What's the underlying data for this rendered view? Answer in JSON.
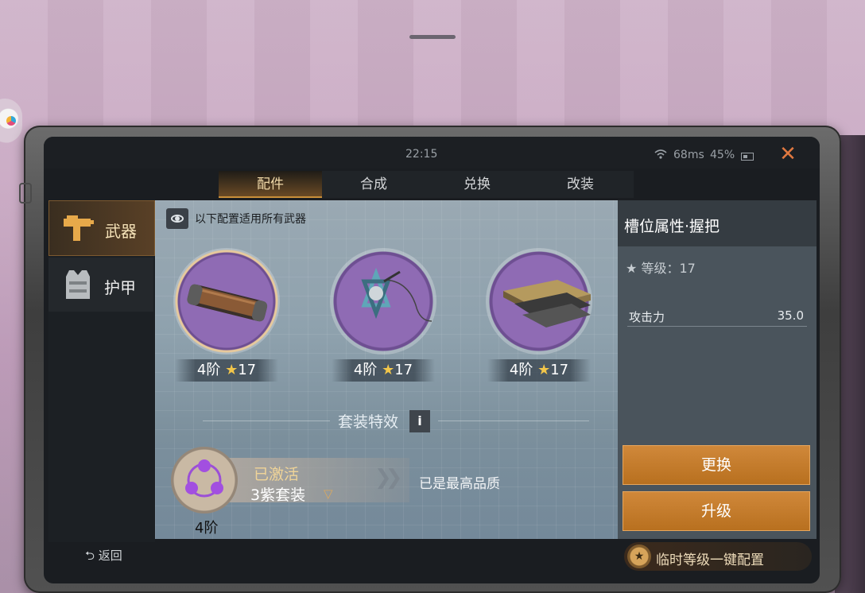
{
  "status": {
    "time": "22:15",
    "ping": "68ms",
    "battery": "45%"
  },
  "tabs": [
    {
      "label": "配件",
      "active": true
    },
    {
      "label": "合成",
      "active": false
    },
    {
      "label": "兑换",
      "active": false
    },
    {
      "label": "改装",
      "active": false
    }
  ],
  "nav": [
    {
      "label": "武器",
      "icon": "smg-icon",
      "active": true
    },
    {
      "label": "护甲",
      "icon": "vest-icon",
      "active": false
    }
  ],
  "notice": "以下配置适用所有武器",
  "slots": [
    {
      "tier": "4阶",
      "star_level": "17",
      "icon": "grip-icon",
      "selected": true
    },
    {
      "tier": "4阶",
      "star_level": "17",
      "icon": "charm-icon",
      "selected": false
    },
    {
      "tier": "4阶",
      "star_level": "17",
      "icon": "plates-icon",
      "selected": false
    }
  ],
  "set_effect": {
    "title": "套装特效",
    "info": "i",
    "activated": "已激活",
    "set_name": "3紫套装",
    "tier": "4阶",
    "max_quality": "已是最高品质"
  },
  "detail": {
    "title": "槽位属性·握把",
    "level": "等级：17",
    "stat_name": "攻击力",
    "stat_value": "35.0",
    "replace": "更换",
    "upgrade": "升级"
  },
  "bottom": {
    "back": "返回",
    "quick_config": "临时等级一键配置"
  },
  "colors": {
    "accent": "#c98f3a",
    "button": "#c47b2c",
    "purple": "#8f6bb4"
  }
}
